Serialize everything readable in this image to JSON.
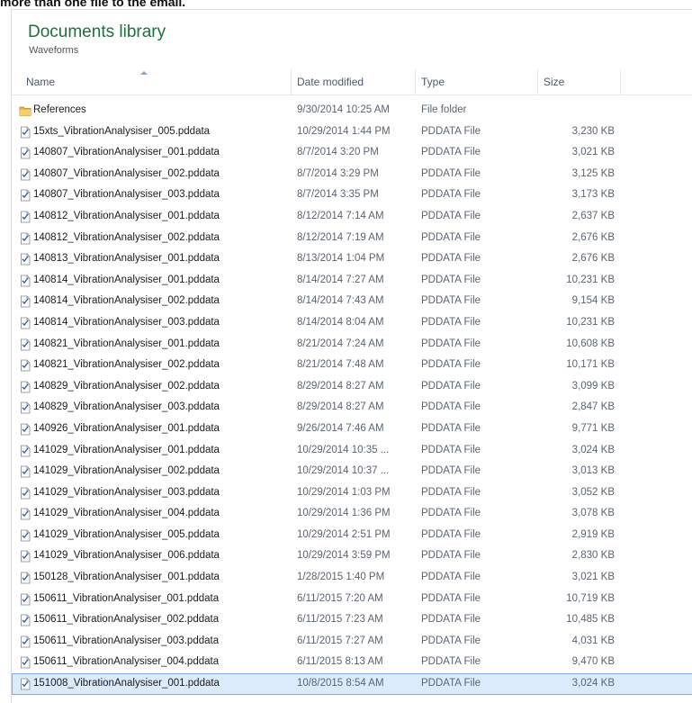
{
  "caption": "more than one file to the email.",
  "library": {
    "title": "Documents library",
    "subtitle": "Waveforms"
  },
  "columns": {
    "name": "Name",
    "date": "Date modified",
    "type": "Type",
    "size": "Size"
  },
  "files": [
    {
      "name": "References",
      "date": "9/30/2014 10:25 AM",
      "type": "File folder",
      "size": "",
      "icon": "folder-icon"
    },
    {
      "name": "15xts_VibrationAnalysiser_005.pddata",
      "date": "10/29/2014 1:44 PM",
      "type": "PDDATA File",
      "size": "3,230 KB",
      "icon": "file-icon"
    },
    {
      "name": "140807_VibrationAnalysiser_001.pddata",
      "date": "8/7/2014 3:20 PM",
      "type": "PDDATA File",
      "size": "3,021 KB",
      "icon": "file-icon"
    },
    {
      "name": "140807_VibrationAnalysiser_002.pddata",
      "date": "8/7/2014 3:29 PM",
      "type": "PDDATA File",
      "size": "3,125 KB",
      "icon": "file-icon"
    },
    {
      "name": "140807_VibrationAnalysiser_003.pddata",
      "date": "8/7/2014 3:35 PM",
      "type": "PDDATA File",
      "size": "3,173 KB",
      "icon": "file-icon"
    },
    {
      "name": "140812_VibrationAnalysiser_001.pddata",
      "date": "8/12/2014 7:14 AM",
      "type": "PDDATA File",
      "size": "2,637 KB",
      "icon": "file-icon"
    },
    {
      "name": "140812_VibrationAnalysiser_002.pddata",
      "date": "8/12/2014 7:19 AM",
      "type": "PDDATA File",
      "size": "2,676 KB",
      "icon": "file-icon"
    },
    {
      "name": "140813_VibrationAnalysiser_001.pddata",
      "date": "8/13/2014 1:04 PM",
      "type": "PDDATA File",
      "size": "2,676 KB",
      "icon": "file-icon"
    },
    {
      "name": "140814_VibrationAnalysiser_001.pddata",
      "date": "8/14/2014 7:27 AM",
      "type": "PDDATA File",
      "size": "10,231 KB",
      "icon": "file-icon"
    },
    {
      "name": "140814_VibrationAnalysiser_002.pddata",
      "date": "8/14/2014 7:43 AM",
      "type": "PDDATA File",
      "size": "9,154 KB",
      "icon": "file-icon"
    },
    {
      "name": "140814_VibrationAnalysiser_003.pddata",
      "date": "8/14/2014 8:04 AM",
      "type": "PDDATA File",
      "size": "10,231 KB",
      "icon": "file-icon"
    },
    {
      "name": "140821_VibrationAnalysiser_001.pddata",
      "date": "8/21/2014 7:24 AM",
      "type": "PDDATA File",
      "size": "10,608 KB",
      "icon": "file-icon"
    },
    {
      "name": "140821_VibrationAnalysiser_002.pddata",
      "date": "8/21/2014 7:48 AM",
      "type": "PDDATA File",
      "size": "10,171 KB",
      "icon": "file-icon"
    },
    {
      "name": "140829_VibrationAnalysiser_002.pddata",
      "date": "8/29/2014 8:27 AM",
      "type": "PDDATA File",
      "size": "3,099 KB",
      "icon": "file-icon"
    },
    {
      "name": "140829_VibrationAnalysiser_003.pddata",
      "date": "8/29/2014 8:27 AM",
      "type": "PDDATA File",
      "size": "2,847 KB",
      "icon": "file-icon"
    },
    {
      "name": "140926_VibrationAnalysiser_001.pddata",
      "date": "9/26/2014 7:46 AM",
      "type": "PDDATA File",
      "size": "9,771 KB",
      "icon": "file-icon"
    },
    {
      "name": "141029_VibrationAnalysiser_001.pddata",
      "date": "10/29/2014 10:35 ...",
      "type": "PDDATA File",
      "size": "3,024 KB",
      "icon": "file-icon"
    },
    {
      "name": "141029_VibrationAnalysiser_002.pddata",
      "date": "10/29/2014 10:37 ...",
      "type": "PDDATA File",
      "size": "3,013 KB",
      "icon": "file-icon"
    },
    {
      "name": "141029_VibrationAnalysiser_003.pddata",
      "date": "10/29/2014 1:03 PM",
      "type": "PDDATA File",
      "size": "3,052 KB",
      "icon": "file-icon"
    },
    {
      "name": "141029_VibrationAnalysiser_004.pddata",
      "date": "10/29/2014 1:36 PM",
      "type": "PDDATA File",
      "size": "3,078 KB",
      "icon": "file-icon"
    },
    {
      "name": "141029_VibrationAnalysiser_005.pddata",
      "date": "10/29/2014 2:51 PM",
      "type": "PDDATA File",
      "size": "2,919 KB",
      "icon": "file-icon"
    },
    {
      "name": "141029_VibrationAnalysiser_006.pddata",
      "date": "10/29/2014 3:59 PM",
      "type": "PDDATA File",
      "size": "2,830 KB",
      "icon": "file-icon"
    },
    {
      "name": "150128_VibrationAnalysiser_001.pddata",
      "date": "1/28/2015 1:40 PM",
      "type": "PDDATA File",
      "size": "3,021 KB",
      "icon": "file-icon"
    },
    {
      "name": "150611_VibrationAnalysiser_001.pddata",
      "date": "6/11/2015 7:20 AM",
      "type": "PDDATA File",
      "size": "10,719 KB",
      "icon": "file-icon"
    },
    {
      "name": "150611_VibrationAnalysiser_002.pddata",
      "date": "6/11/2015 7:23 AM",
      "type": "PDDATA File",
      "size": "10,485 KB",
      "icon": "file-icon"
    },
    {
      "name": "150611_VibrationAnalysiser_003.pddata",
      "date": "6/11/2015 7:27 AM",
      "type": "PDDATA File",
      "size": "4,031 KB",
      "icon": "file-icon"
    },
    {
      "name": "150611_VibrationAnalysiser_004.pddata",
      "date": "6/11/2015 8:13 AM",
      "type": "PDDATA File",
      "size": "9,470 KB",
      "icon": "file-icon"
    },
    {
      "name": "151008_VibrationAnalysiser_001.pddata",
      "date": "10/8/2015 8:54 AM",
      "type": "PDDATA File",
      "size": "3,024 KB",
      "icon": "file-icon",
      "selected": true
    }
  ],
  "colors": {
    "library_title": "#1e6f3a",
    "selection_bg": "#dcebfc",
    "selection_border": "#84acdd"
  }
}
